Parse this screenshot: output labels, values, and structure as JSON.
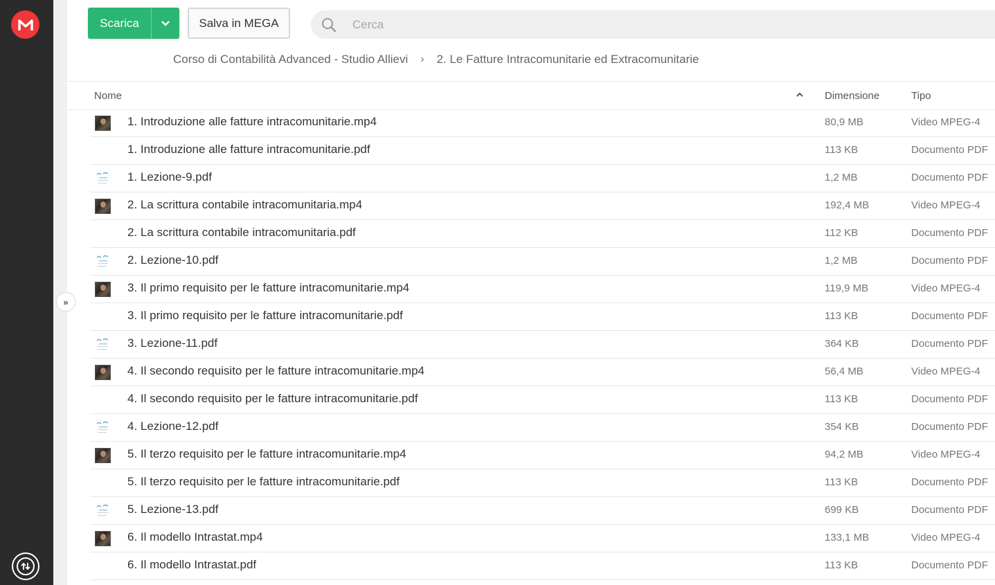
{
  "toolbar": {
    "download_label": "Scarica",
    "save_label": "Salva in MEGA",
    "search_placeholder": "Cerca"
  },
  "breadcrumb": [
    "Corso di Contabilità Advanced - Studio Allievi",
    "2. Le Fatture Intracomunitarie ed Extracomunitarie"
  ],
  "columns": {
    "name": "Nome",
    "size": "Dimensione",
    "type": "Tipo"
  },
  "colors": {
    "accent": "#2bb673",
    "logo": "#f0373a",
    "sidebar": "#2b2b2b"
  },
  "files": [
    {
      "name": "1. Introduzione alle fatture intracomunitarie.mp4",
      "size": "80,9 MB",
      "type": "Video MPEG-4",
      "thumb": "video"
    },
    {
      "name": "1. Introduzione alle fatture intracomunitarie.pdf",
      "size": "113 KB",
      "type": "Documento PDF",
      "thumb": "none"
    },
    {
      "name": "1. Lezione-9.pdf",
      "size": "1,2 MB",
      "type": "Documento PDF",
      "thumb": "doc"
    },
    {
      "name": "2. La scrittura contabile intracomunitaria.mp4",
      "size": "192,4 MB",
      "type": "Video MPEG-4",
      "thumb": "video"
    },
    {
      "name": "2. La scrittura contabile intracomunitaria.pdf",
      "size": "112 KB",
      "type": "Documento PDF",
      "thumb": "none"
    },
    {
      "name": "2. Lezione-10.pdf",
      "size": "1,2 MB",
      "type": "Documento PDF",
      "thumb": "doc"
    },
    {
      "name": "3. Il primo requisito per le fatture intracomunitarie.mp4",
      "size": "119,9 MB",
      "type": "Video MPEG-4",
      "thumb": "video"
    },
    {
      "name": "3. Il primo requisito per le fatture intracomunitarie.pdf",
      "size": "113 KB",
      "type": "Documento PDF",
      "thumb": "none"
    },
    {
      "name": "3. Lezione-11.pdf",
      "size": "364 KB",
      "type": "Documento PDF",
      "thumb": "doc"
    },
    {
      "name": "4. Il secondo requisito per le fatture intracomunitarie.mp4",
      "size": "56,4 MB",
      "type": "Video MPEG-4",
      "thumb": "video"
    },
    {
      "name": "4. Il secondo requisito per le fatture intracomunitarie.pdf",
      "size": "113 KB",
      "type": "Documento PDF",
      "thumb": "none"
    },
    {
      "name": "4. Lezione-12.pdf",
      "size": "354 KB",
      "type": "Documento PDF",
      "thumb": "doc"
    },
    {
      "name": "5. Il terzo requisito per le fatture intracomunitarie.mp4",
      "size": "94,2 MB",
      "type": "Video MPEG-4",
      "thumb": "video"
    },
    {
      "name": "5. Il terzo requisito per le fatture intracomunitarie.pdf",
      "size": "113 KB",
      "type": "Documento PDF",
      "thumb": "none"
    },
    {
      "name": "5. Lezione-13.pdf",
      "size": "699 KB",
      "type": "Documento PDF",
      "thumb": "doc"
    },
    {
      "name": "6. Il modello Intrastat.mp4",
      "size": "133,1 MB",
      "type": "Video MPEG-4",
      "thumb": "video"
    },
    {
      "name": "6. Il modello Intrastat.pdf",
      "size": "113 KB",
      "type": "Documento PDF",
      "thumb": "none"
    }
  ]
}
